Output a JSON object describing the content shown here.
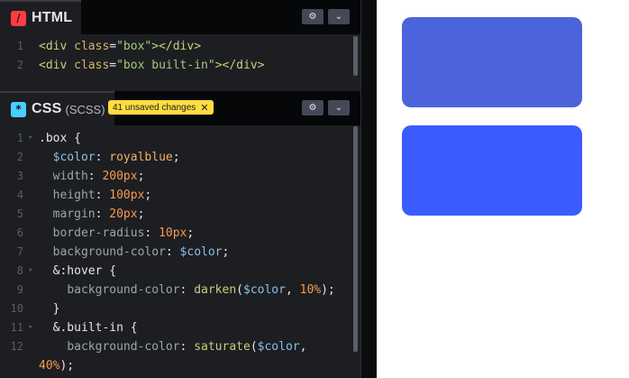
{
  "html_pane": {
    "title": "HTML",
    "icon": "html-slash-icon",
    "icon_glyph": "/",
    "color": "#ff3c41",
    "lines": [
      {
        "num": "1",
        "segments": [
          {
            "cls": "t-tag",
            "text": "<"
          },
          {
            "cls": "t-tagname",
            "text": "div"
          },
          {
            "cls": "t-punc",
            "text": " "
          },
          {
            "cls": "t-attr",
            "text": "class"
          },
          {
            "cls": "t-punc",
            "text": "="
          },
          {
            "cls": "t-str",
            "text": "\"box\""
          },
          {
            "cls": "t-tag",
            "text": "></"
          },
          {
            "cls": "t-tagname",
            "text": "div"
          },
          {
            "cls": "t-tag",
            "text": ">"
          }
        ]
      },
      {
        "num": "2",
        "segments": [
          {
            "cls": "t-tag",
            "text": "<"
          },
          {
            "cls": "t-tagname",
            "text": "div"
          },
          {
            "cls": "t-punc",
            "text": " "
          },
          {
            "cls": "t-attr",
            "text": "class"
          },
          {
            "cls": "t-punc",
            "text": "="
          },
          {
            "cls": "t-str",
            "text": "\"box built-in\""
          },
          {
            "cls": "t-tag",
            "text": "></"
          },
          {
            "cls": "t-tagname",
            "text": "div"
          },
          {
            "cls": "t-tag",
            "text": ">"
          }
        ]
      }
    ]
  },
  "css_pane": {
    "title": "CSS",
    "subtitle": "(SCSS)",
    "icon": "css-asterisk-icon",
    "icon_glyph": "*",
    "color": "#47cfff",
    "unsaved_label": "41 unsaved changes",
    "lines": [
      {
        "num": "1",
        "fold": true,
        "segments": [
          {
            "cls": "t-sel",
            "text": ".box {"
          }
        ]
      },
      {
        "num": "2",
        "segments": [
          {
            "cls": "t-punc",
            "text": "  "
          },
          {
            "cls": "t-var",
            "text": "$color"
          },
          {
            "cls": "t-punc",
            "text": ": "
          },
          {
            "cls": "t-val",
            "text": "royalblue"
          },
          {
            "cls": "t-punc",
            "text": ";"
          }
        ]
      },
      {
        "num": "3",
        "segments": [
          {
            "cls": "t-punc",
            "text": "  "
          },
          {
            "cls": "t-prop",
            "text": "width"
          },
          {
            "cls": "t-punc",
            "text": ": "
          },
          {
            "cls": "t-num",
            "text": "200px"
          },
          {
            "cls": "t-punc",
            "text": ";"
          }
        ]
      },
      {
        "num": "4",
        "segments": [
          {
            "cls": "t-punc",
            "text": "  "
          },
          {
            "cls": "t-prop",
            "text": "height"
          },
          {
            "cls": "t-punc",
            "text": ": "
          },
          {
            "cls": "t-num",
            "text": "100px"
          },
          {
            "cls": "t-punc",
            "text": ";"
          }
        ]
      },
      {
        "num": "5",
        "segments": [
          {
            "cls": "t-punc",
            "text": "  "
          },
          {
            "cls": "t-prop",
            "text": "margin"
          },
          {
            "cls": "t-punc",
            "text": ": "
          },
          {
            "cls": "t-num",
            "text": "20px"
          },
          {
            "cls": "t-punc",
            "text": ";"
          }
        ]
      },
      {
        "num": "6",
        "segments": [
          {
            "cls": "t-punc",
            "text": "  "
          },
          {
            "cls": "t-prop",
            "text": "border-radius"
          },
          {
            "cls": "t-punc",
            "text": ": "
          },
          {
            "cls": "t-num",
            "text": "10px"
          },
          {
            "cls": "t-punc",
            "text": ";"
          }
        ]
      },
      {
        "num": "7",
        "segments": [
          {
            "cls": "t-punc",
            "text": "  "
          },
          {
            "cls": "t-prop",
            "text": "background-color"
          },
          {
            "cls": "t-punc",
            "text": ": "
          },
          {
            "cls": "t-var",
            "text": "$color"
          },
          {
            "cls": "t-punc",
            "text": ";"
          }
        ]
      },
      {
        "num": "8",
        "fold": true,
        "segments": [
          {
            "cls": "t-punc",
            "text": "  "
          },
          {
            "cls": "t-sel",
            "text": "&:hover {"
          }
        ]
      },
      {
        "num": "9",
        "segments": [
          {
            "cls": "t-punc",
            "text": "    "
          },
          {
            "cls": "t-prop",
            "text": "background-color"
          },
          {
            "cls": "t-punc",
            "text": ": "
          },
          {
            "cls": "t-fn",
            "text": "darken"
          },
          {
            "cls": "t-punc",
            "text": "("
          },
          {
            "cls": "t-var",
            "text": "$color"
          },
          {
            "cls": "t-punc",
            "text": ", "
          },
          {
            "cls": "t-num",
            "text": "10%"
          },
          {
            "cls": "t-punc",
            "text": ");"
          }
        ]
      },
      {
        "num": "10",
        "segments": [
          {
            "cls": "t-punc",
            "text": "  }"
          }
        ]
      },
      {
        "num": "11",
        "fold": true,
        "segments": [
          {
            "cls": "t-punc",
            "text": "  "
          },
          {
            "cls": "t-sel",
            "text": "&.built-in {"
          }
        ]
      },
      {
        "num": "12",
        "segments": [
          {
            "cls": "t-punc",
            "text": "    "
          },
          {
            "cls": "t-prop",
            "text": "background-color"
          },
          {
            "cls": "t-punc",
            "text": ": "
          },
          {
            "cls": "t-fn",
            "text": "saturate"
          },
          {
            "cls": "t-punc",
            "text": "("
          },
          {
            "cls": "t-var",
            "text": "$color"
          },
          {
            "cls": "t-punc",
            "text": ","
          }
        ]
      },
      {
        "num": "",
        "segments": [
          {
            "cls": "t-num",
            "text": "40%"
          },
          {
            "cls": "t-punc",
            "text": ");"
          }
        ]
      }
    ]
  },
  "controls": {
    "settings_icon": "gear-icon",
    "collapse_icon": "chevron-down-icon"
  },
  "preview": {
    "box_color": "#4b64dc",
    "built_in_color": "#3c5bff"
  }
}
